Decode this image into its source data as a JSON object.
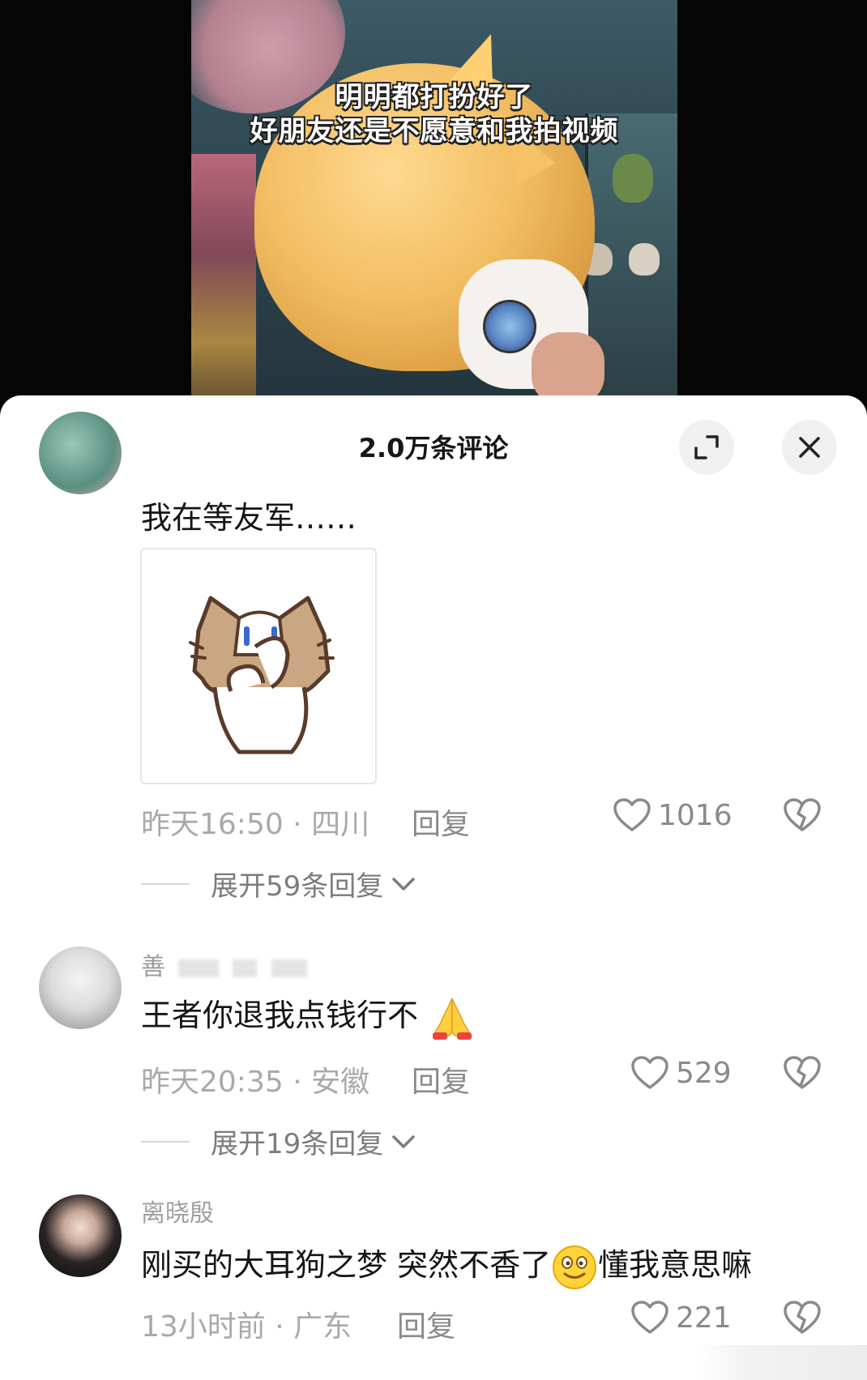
{
  "video": {
    "caption_line1": "明明都打扮好了",
    "caption_line2": "好朋友还是不愿意和我拍视频"
  },
  "sheet": {
    "title": "2.0万条评论",
    "expand_icon": "expand-icon",
    "close_icon": "close-icon"
  },
  "comments": [
    {
      "text": "我在等友军……",
      "sticker": "cat-peek-sticker",
      "time": "昨天16:50",
      "location": "四川",
      "reply_label": "回复",
      "likes": "1016",
      "expand_label": "展开59条回复"
    },
    {
      "username": "善",
      "text": "王者你退我点钱行不",
      "emoji": "folded-hands-emoji",
      "time": "昨天20:35",
      "location": "安徽",
      "reply_label": "回复",
      "likes": "529",
      "expand_label": "展开19条回复"
    },
    {
      "username": "离晓殷",
      "text_part1": "刚买的大耳狗之梦 突然不香了",
      "emoji": "grinning-face-emoji",
      "text_part2": "懂我意思嘛",
      "time": "13小时前",
      "location": "广东",
      "reply_label": "回复",
      "likes": "221"
    }
  ],
  "separator": " · "
}
